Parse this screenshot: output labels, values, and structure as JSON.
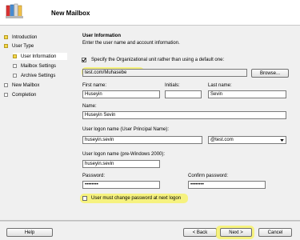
{
  "window": {
    "title": "New Mailbox"
  },
  "nav": {
    "items": [
      {
        "label": "Introduction"
      },
      {
        "label": "User Type"
      },
      {
        "label": "User Information"
      },
      {
        "label": "Mailbox Settings"
      },
      {
        "label": "Archive Settings"
      },
      {
        "label": "New Mailbox"
      },
      {
        "label": "Completion"
      }
    ]
  },
  "page": {
    "heading": "User Information",
    "subtitle": "Enter the user name and account information."
  },
  "ou": {
    "checkbox_label": "Specify the Organizational unit rather than using a default one:",
    "value": "test.com/Muhasebe",
    "browse": "Browse..."
  },
  "fields": {
    "first_name_label": "First name:",
    "first_name": "Huseyin",
    "initials_label": "Initials:",
    "initials": "",
    "last_name_label": "Last name:",
    "last_name": "Sevin",
    "name_label": "Name:",
    "name": "Huseyin Sevin",
    "upn_label": "User logon name (User Principal Name):",
    "upn": "huseyin.sevin",
    "domain": "@test.com",
    "pre2000_label": "User logon name (pre-Windows 2000):",
    "pre2000": "huseyin.sevin",
    "password_label": "Password:",
    "password": "••••••••",
    "confirm_label": "Confirm password:",
    "confirm": "••••••••",
    "must_change_label": "User must change password at next logon"
  },
  "footer": {
    "help": "Help",
    "back": "< Back",
    "next": "Next >",
    "cancel": "Cancel"
  }
}
